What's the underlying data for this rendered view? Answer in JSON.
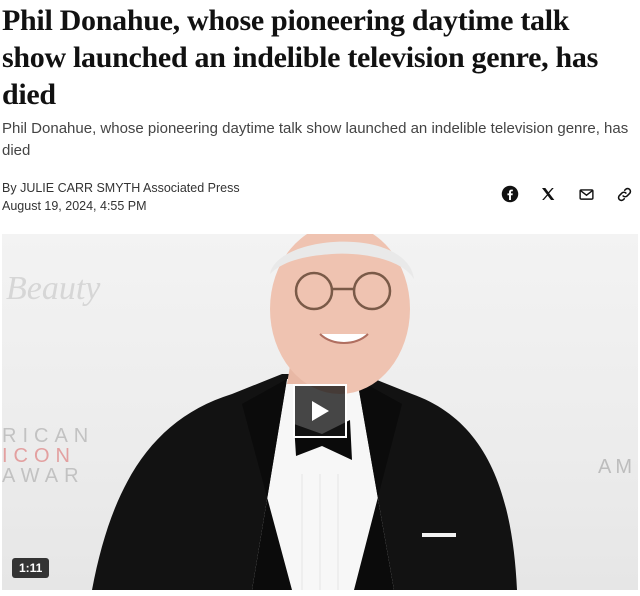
{
  "article": {
    "headline": "Phil Donahue, whose pioneering daytime talk show launched an indelible television genre, has died",
    "subhead": "Phil Donahue, whose pioneering daytime talk show launched an indelible television genre, has died",
    "byline_prefix": "By ",
    "author": "JULIE CARR SMYTH",
    "organization": " Associated Press",
    "date": "August 19, 2024, 4:55 PM"
  },
  "share": {
    "icons": [
      "facebook-icon",
      "x-icon",
      "email-icon",
      "link-icon"
    ]
  },
  "media": {
    "backdrop_word": "Beauty",
    "backdrop_left_lines": [
      "RICAN",
      "ICON",
      "AWAR"
    ],
    "backdrop_right": "AM",
    "duration": "1:11",
    "colors": {
      "backdrop_text": "#bdbdbd",
      "backdrop_accent": "#e08a8a"
    }
  }
}
